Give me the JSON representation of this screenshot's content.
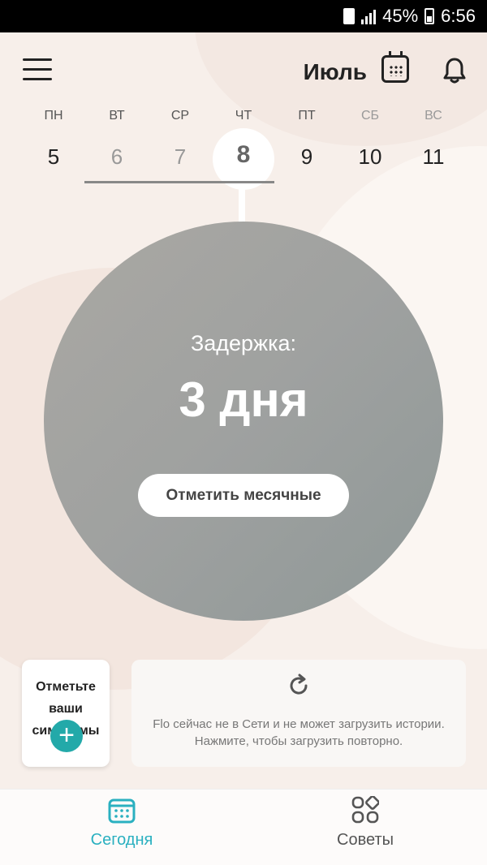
{
  "status_bar": {
    "battery": "45%",
    "time": "6:56"
  },
  "header": {
    "month": "Июль"
  },
  "week": {
    "days": [
      {
        "name": "ПН",
        "num": "5"
      },
      {
        "name": "ВТ",
        "num": "6"
      },
      {
        "name": "СР",
        "num": "7"
      },
      {
        "name": "ЧТ",
        "num": "8"
      },
      {
        "name": "ПТ",
        "num": "9"
      },
      {
        "name": "СБ",
        "num": "10"
      },
      {
        "name": "ВС",
        "num": "11"
      }
    ]
  },
  "main": {
    "delay_label": "Задержка:",
    "delay_value": "3 дня",
    "log_period_label": "Отметить месячные"
  },
  "symptoms_card": {
    "text": "Отметьте ваши симптомы"
  },
  "offline_card": {
    "text": "Flo сейчас не в Сети и не может загрузить истории. Нажмите, чтобы загрузить повторно."
  },
  "nav": {
    "today_label": "Сегодня",
    "tips_label": "Советы"
  },
  "colors": {
    "accent": "#23a9a9",
    "nav_active": "#2ab0c0",
    "circle": "#9fa1a0"
  }
}
